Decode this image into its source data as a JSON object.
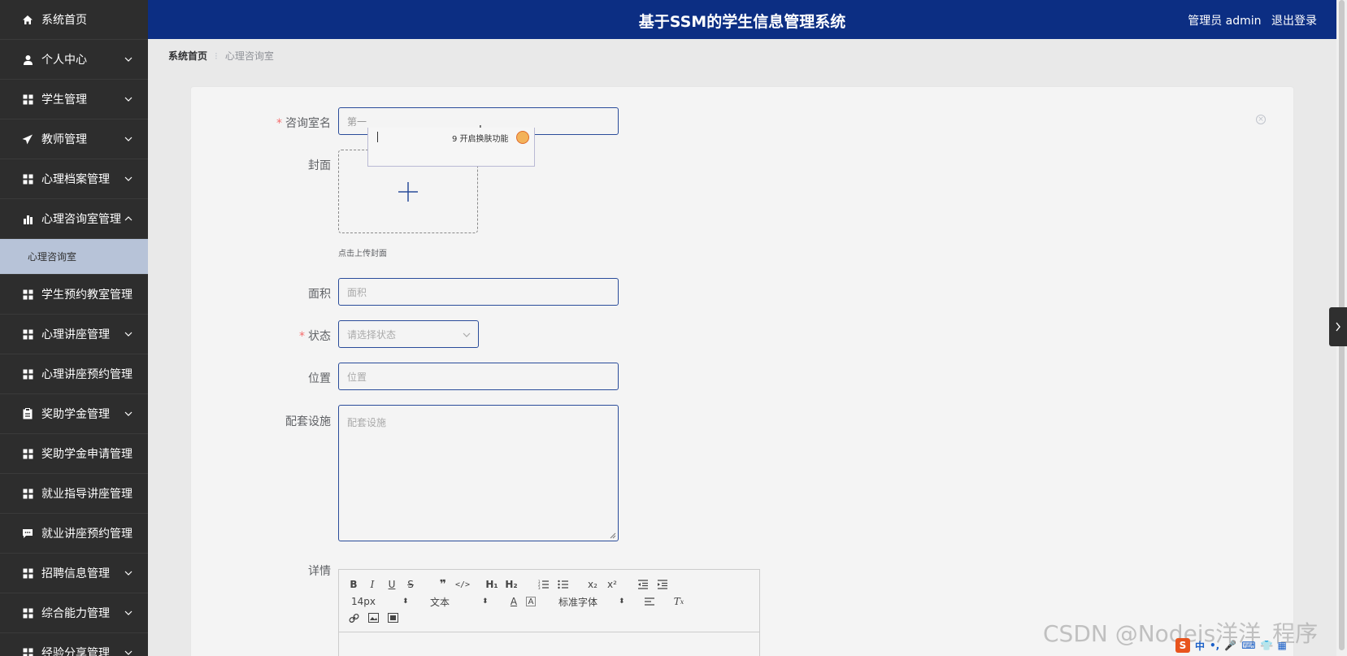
{
  "header": {
    "title": "基于SSM的学生信息管理系统",
    "user_label": "管理员 admin",
    "logout": "退出登录"
  },
  "sidebar": {
    "items": [
      {
        "label": "系统首页",
        "icon": "home-icon",
        "has_chevron": false
      },
      {
        "label": "个人中心",
        "icon": "user-icon",
        "has_chevron": true
      },
      {
        "label": "学生管理",
        "icon": "grid-icon",
        "has_chevron": true
      },
      {
        "label": "教师管理",
        "icon": "send-icon",
        "has_chevron": true
      },
      {
        "label": "心理档案管理",
        "icon": "grid-icon",
        "has_chevron": true
      },
      {
        "label": "心理咨询室管理",
        "icon": "bar-chart-icon",
        "has_chevron": true,
        "expanded": true
      },
      {
        "label": "学生预约教室管理",
        "icon": "grid-icon",
        "has_chevron": false
      },
      {
        "label": "心理讲座管理",
        "icon": "grid-icon",
        "has_chevron": true
      },
      {
        "label": "心理讲座预约管理",
        "icon": "grid-icon",
        "has_chevron": false
      },
      {
        "label": "奖助学金管理",
        "icon": "clipboard-icon",
        "has_chevron": true
      },
      {
        "label": "奖助学金申请管理",
        "icon": "grid-icon",
        "has_chevron": false
      },
      {
        "label": "就业指导讲座管理",
        "icon": "grid-icon",
        "has_chevron": false
      },
      {
        "label": "就业讲座预约管理",
        "icon": "chat-icon",
        "has_chevron": false
      },
      {
        "label": "招聘信息管理",
        "icon": "grid-icon",
        "has_chevron": true
      },
      {
        "label": "综合能力管理",
        "icon": "grid-icon",
        "has_chevron": true
      },
      {
        "label": "经验分享管理",
        "icon": "grid-icon",
        "has_chevron": true
      }
    ],
    "submenu": {
      "label": "心理咨询室"
    }
  },
  "breadcrumb": {
    "home": "系统首页",
    "current": "心理咨询室"
  },
  "form": {
    "name": {
      "label": "咨询室名",
      "value": "第一",
      "required": true
    },
    "cover": {
      "label": "封面",
      "hint": "点击上传封面"
    },
    "area": {
      "label": "面积",
      "placeholder": "面积"
    },
    "status": {
      "label": "状态",
      "placeholder": "请选择状态",
      "required": true
    },
    "location": {
      "label": "位置",
      "placeholder": "位置"
    },
    "facilities": {
      "label": "配套设施",
      "placeholder": "配套设施"
    },
    "details": {
      "label": "详情"
    }
  },
  "ime_popup": {
    "cursor_text": "I",
    "hint": "9 开启换肤功能"
  },
  "editor": {
    "font_size": "14px",
    "text_style": "文本",
    "font_family": "标准字体",
    "h1": "H₁",
    "h2": "H₂",
    "subscript": "x₂",
    "superscript": "x²"
  },
  "watermark": "CSDN @Nodeis洋洋_程序",
  "tray": {
    "input_mode": "中"
  }
}
